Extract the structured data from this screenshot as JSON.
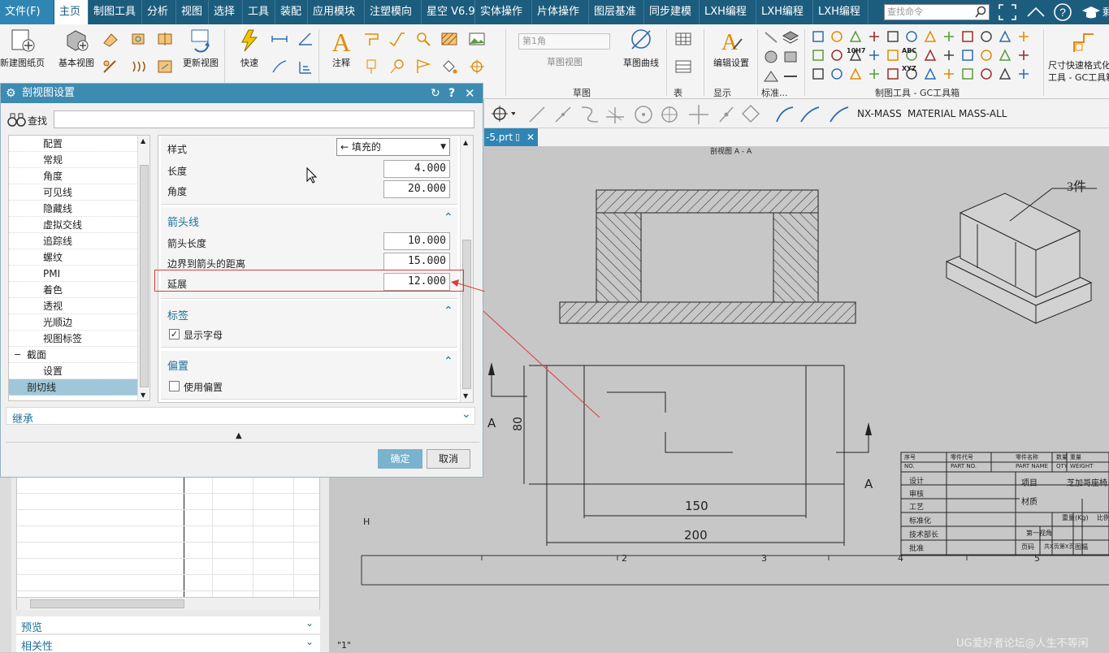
{
  "menubar": {
    "file": "文件(F)",
    "tabs": [
      "主页",
      "制图工具",
      "分析",
      "视图",
      "选择",
      "工具",
      "装配",
      "应用模块",
      "注塑模向",
      "星空 V6.9",
      "实体操作",
      "片体操作",
      "图层基准",
      "同步建模",
      "LXH编程",
      "LXH编程",
      "LXH编程"
    ],
    "active": "主页",
    "search_placeholder": "查找命令"
  },
  "ribbon": {
    "new_sheet": "新建图纸页",
    "base_view": "基本视图",
    "update_view": "更新视图",
    "quick": "快速",
    "annotation": "注释",
    "sketch_view": "草图视图",
    "sketch_curve": "草图曲线",
    "edit_settings": "编辑设置",
    "sheet_combo": "第1角",
    "sketch_group": "草图",
    "table_group": "表",
    "display_group": "显示",
    "std_group": "标准...",
    "gc_group": "制图工具 - GC工具箱",
    "dim_quick": "尺寸快速格式化",
    "gc_tools": "工具 - GC工具箱",
    "tool_labels": [
      "10H7",
      "ABC",
      "XYZ"
    ]
  },
  "toolbar2": {
    "nx_mass": "NX-MASS",
    "material": "MATERIAL",
    "mass_all": "MASS-ALL"
  },
  "file_tab": "-5.prt",
  "dialog": {
    "title": "剖视图设置",
    "find_label": "查找",
    "tree": [
      {
        "label": "配置",
        "indent": 2
      },
      {
        "label": "常规",
        "indent": 2
      },
      {
        "label": "角度",
        "indent": 2
      },
      {
        "label": "可见线",
        "indent": 2
      },
      {
        "label": "隐藏线",
        "indent": 2
      },
      {
        "label": "虚拟交线",
        "indent": 2
      },
      {
        "label": "追踪线",
        "indent": 2
      },
      {
        "label": "螺纹",
        "indent": 2
      },
      {
        "label": "PMI",
        "indent": 2
      },
      {
        "label": "着色",
        "indent": 2
      },
      {
        "label": "透视",
        "indent": 2
      },
      {
        "label": "光顺边",
        "indent": 2
      },
      {
        "label": "视图标签",
        "indent": 2
      },
      {
        "label": "截面",
        "indent": 1
      },
      {
        "label": "设置",
        "indent": 2
      },
      {
        "label": "剖切线",
        "indent": 1
      }
    ],
    "selected": "剖切线",
    "props": {
      "style_label": "样式",
      "style_value": "← 填充的",
      "length_label": "长度",
      "length_value": "4.000",
      "angle_label": "角度",
      "angle_value": "20.000",
      "arrow_section": "箭头线",
      "arrow_length_label": "箭头长度",
      "arrow_length_value": "10.000",
      "border_dist_label": "边界到箭头的距离",
      "border_dist_value": "15.000",
      "extend_label": "延展",
      "extend_value": "12.000",
      "label_section": "标签",
      "show_letter": "显示字母",
      "offset_section": "偏置",
      "use_offset": "使用偏置"
    },
    "inherit": "继承",
    "ok": "确定",
    "cancel": "取消"
  },
  "leftpanel": {
    "preview": "预览",
    "relevance": "相关性"
  },
  "drawing": {
    "view_title": "剖视图 A - A",
    "part_label": "3件",
    "dim_150": "150",
    "dim_200": "200",
    "dim_80": "80",
    "section_A": "A",
    "section_A2": "A",
    "grid_nums": [
      "2",
      "3",
      "4",
      "5"
    ],
    "grid_H": "H",
    "bottom_label": "\"1\"",
    "tb_header": [
      "序号",
      "零件代号",
      "零件名称",
      "数量",
      "重量"
    ],
    "tb_header_en": [
      "NO.",
      "PART NO.",
      "PART NAME",
      "QTY",
      "WEIGHT"
    ],
    "tb_rows": [
      "设计",
      "审核",
      "工艺",
      "标准化",
      "技术部长",
      "批准"
    ],
    "tb_item": "项目",
    "tb_item_value": "芝加哥座椅",
    "tb_material": "材质",
    "tb_weight": "重量(Kg)",
    "tb_ratio": "比例",
    "tb_first_angle": "第一视角",
    "tb_page": "页码",
    "tb_total": "共X页第X页",
    "tb_sheet": "图幅",
    "watermark": "UG爱好者论坛@人生不等闲"
  },
  "colors": {
    "menubar": "#1c5d7e",
    "dialog_title": "#3d8bb0",
    "selection": "#9fc7d9",
    "highlight": "#e03a3a",
    "accent": "#2f86b4"
  }
}
